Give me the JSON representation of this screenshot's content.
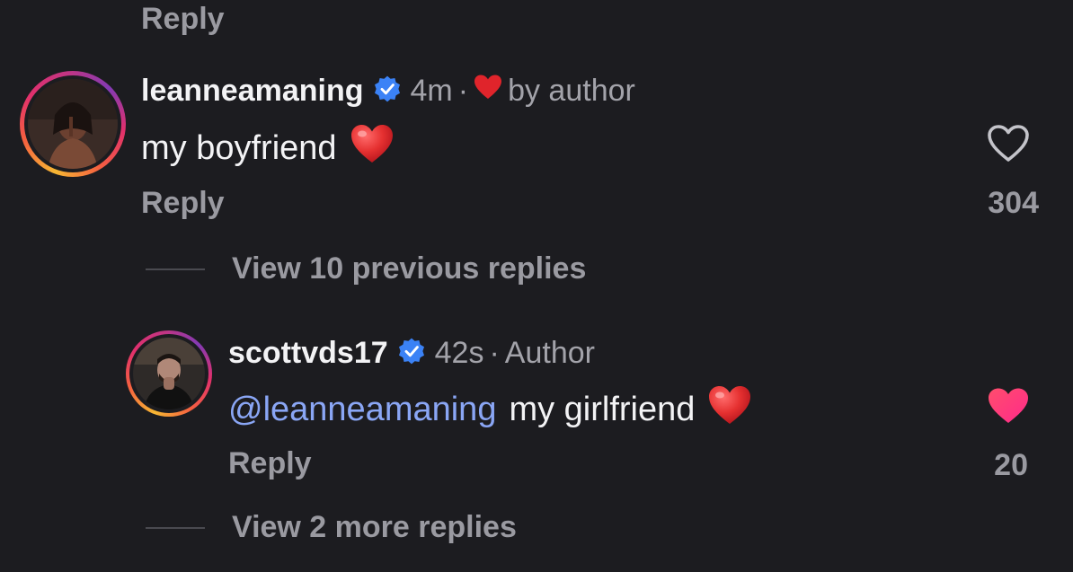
{
  "top": {
    "reply_label": "Reply"
  },
  "comment1": {
    "username": "leanneamaning",
    "time": "4m",
    "separator": "·",
    "liked_by": "by author",
    "text": "my boyfriend",
    "reply_label": "Reply",
    "likes": "304",
    "liked": false
  },
  "view_previous": {
    "label": "View 10 previous replies"
  },
  "comment2": {
    "username": "scottvds17",
    "time": "42s",
    "separator": "·",
    "role": "Author",
    "mention": "@leanneamaning",
    "text": "my girlfriend",
    "reply_label": "Reply",
    "likes": "20",
    "liked": true
  },
  "view_more": {
    "label": "View 2 more replies"
  },
  "icons": {
    "verified": "verified-badge-icon",
    "heart_emoji": "red-heart-emoji",
    "like_outline": "heart-outline-icon",
    "like_filled": "heart-filled-icon"
  },
  "colors": {
    "background": "#1c1c20",
    "mention": "#8aa6f5",
    "verified": "#3b82f6",
    "liked_heart": "#ff3a6e",
    "emoji_heart": "#e0242b"
  }
}
